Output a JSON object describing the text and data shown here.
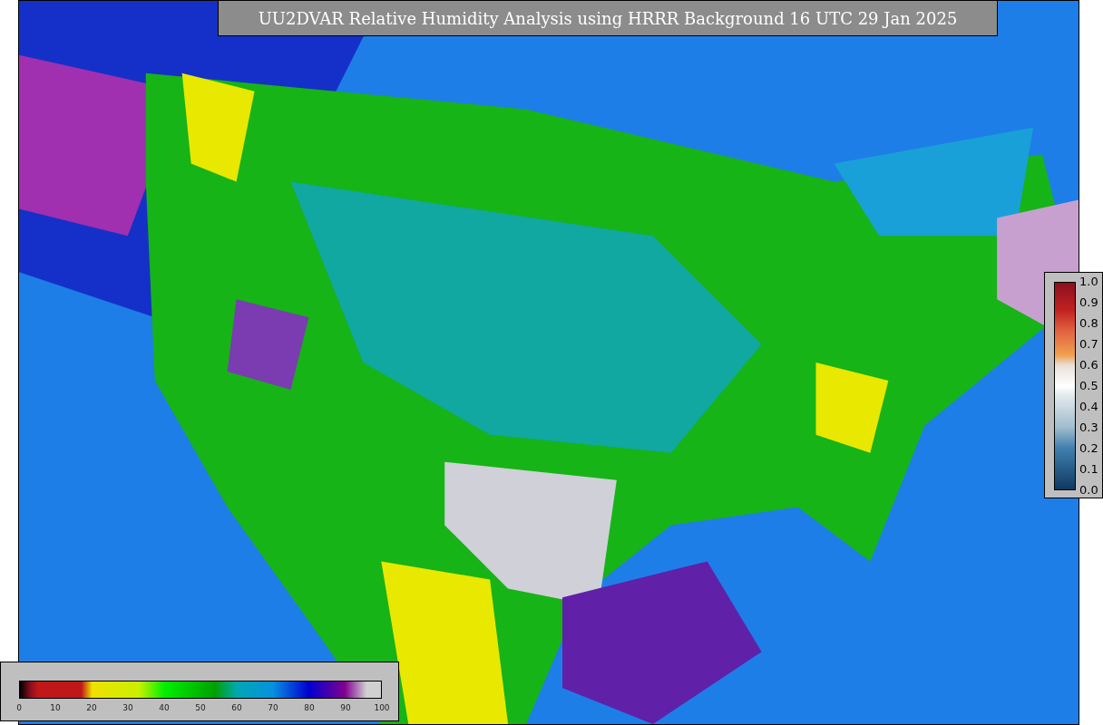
{
  "title": "UU2DVAR Relative Humidity Analysis using HRRR Background 16 UTC 29 Jan 2025",
  "colorbar_bottom": {
    "ticks": [
      "0",
      "10",
      "20",
      "30",
      "40",
      "50",
      "60",
      "70",
      "80",
      "90",
      "100"
    ]
  },
  "colorbar_right": {
    "ticks": [
      "1.0",
      "0.9",
      "0.8",
      "0.7",
      "0.6",
      "0.5",
      "0.4",
      "0.3",
      "0.2",
      "0.1",
      "0.0"
    ]
  }
}
